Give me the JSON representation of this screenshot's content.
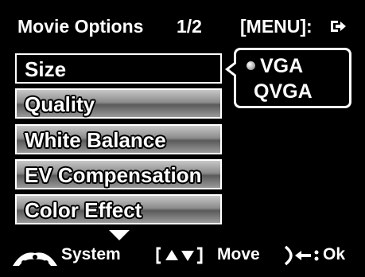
{
  "header": {
    "title": "Movie Options",
    "page": "1/2",
    "menu_hint": "[MENU]:",
    "exit_icon": "exit-arrow-icon"
  },
  "menu": {
    "items": [
      {
        "label": "Size",
        "selected": true
      },
      {
        "label": "Quality",
        "selected": false
      },
      {
        "label": "White Balance",
        "selected": false
      },
      {
        "label": "EV Compensation",
        "selected": false
      },
      {
        "label": "Color Effect",
        "selected": false
      }
    ],
    "more_below": true
  },
  "submenu": {
    "options": [
      {
        "label": "VGA",
        "selected": true
      },
      {
        "label": "QVGA",
        "selected": false
      }
    ]
  },
  "footer": {
    "system_label": "System",
    "move_label": "Move",
    "ok_label": "Ok",
    "icons": [
      "system-icon",
      "up-down-keys-icon",
      "ok-joystick-icon"
    ]
  },
  "colors": {
    "background": "#000000",
    "text": "#ffffff",
    "item_gradient_light": "#c8c8c8",
    "item_gradient_dark": "#5a5a5a"
  }
}
